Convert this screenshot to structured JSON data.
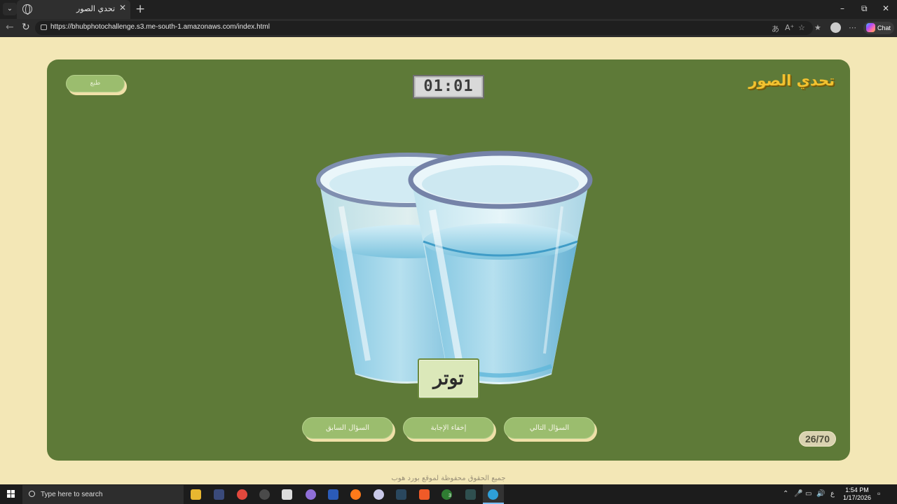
{
  "browser": {
    "tab_title": "تحدي الصور",
    "url": "https://bhubphotochallenge.s3.me-south-1.amazonaws.com/index.html",
    "chat_label": "Chat"
  },
  "game": {
    "logo": "تحدي الصور",
    "timer": "01:01",
    "print_label": "طبع",
    "word": "توتر",
    "counter": "26/70",
    "buttons": {
      "prev": "السؤال السابق",
      "hide_answer": "إخفاء الإجابة",
      "next": "السؤال التالي"
    },
    "image_subject": "two-water-glasses"
  },
  "footer": "جميع الحقوق محفوظة لموقع بورد هوب",
  "taskbar": {
    "search_placeholder": "Type here to search",
    "lang": "ع",
    "time": "1:54 PM",
    "date": "1/17/2026",
    "xbox_badge": "3"
  },
  "colors": {
    "board": "#5e7a38",
    "background": "#f3e7b6",
    "button": "#9bbd6e",
    "logo": "#f2c230"
  }
}
